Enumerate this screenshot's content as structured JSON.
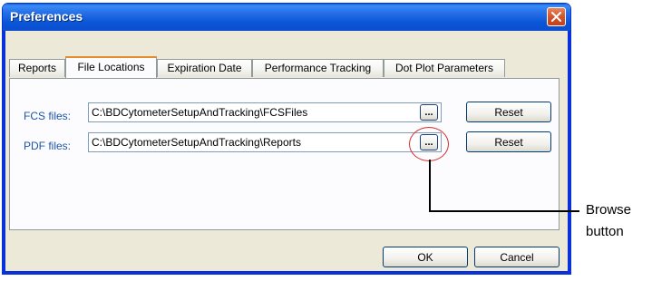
{
  "window": {
    "title": "Preferences"
  },
  "tabs": [
    {
      "label": "Reports",
      "active": false
    },
    {
      "label": "File Locations",
      "active": true
    },
    {
      "label": "Expiration Date",
      "active": false
    },
    {
      "label": "Performance Tracking",
      "active": false
    },
    {
      "label": "Dot Plot Parameters",
      "active": false
    }
  ],
  "file_locations": {
    "fcs": {
      "label": "FCS files:",
      "value": "C:\\BDCytometerSetupAndTracking\\FCSFiles",
      "browse_label": "...",
      "reset_label": "Reset"
    },
    "pdf": {
      "label": "PDF files:",
      "value": "C:\\BDCytometerSetupAndTracking\\Reports",
      "browse_label": "...",
      "reset_label": "Reset"
    }
  },
  "footer": {
    "ok_label": "OK",
    "cancel_label": "Cancel"
  },
  "annotation": {
    "line1": "Browse",
    "line2": "button",
    "highlight_color": "#d62a2a"
  },
  "icons": {
    "close": "close-x-icon"
  }
}
